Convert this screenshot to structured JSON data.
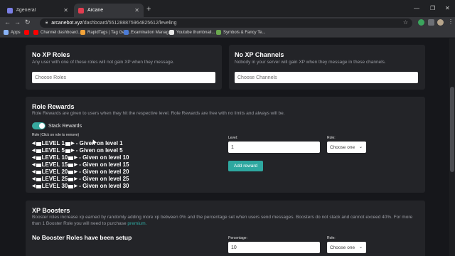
{
  "browser": {
    "tabs": [
      {
        "label": "#general",
        "active": false
      },
      {
        "label": "Arcane",
        "active": true
      }
    ],
    "url_host": "arcanebot.xyz",
    "url_path": "/dashboard/551288875964825612/leveling",
    "bookmarks": [
      "Apps",
      "Channel dashboard...",
      "RapidTags | Tag Gen...",
      "Examination Manag...",
      "Youtube thumbnail...",
      "Symbols & Fancy Te..."
    ]
  },
  "no_xp_roles": {
    "title": "No XP Roles",
    "description": "Any user with one of these roles will not gain XP when they message.",
    "placeholder": "Choose Roles"
  },
  "no_xp_channels": {
    "title": "No XP Channels",
    "description": "Nobody in your server will gain XP when they message in these channels.",
    "placeholder": "Choose Channels"
  },
  "role_rewards": {
    "title": "Role Rewards",
    "description": "Role Rewards are given to users when they hit the respective level. Role Rewards are free with no limits and always will be.",
    "stack_label": "Stack Rewards",
    "stack_enabled": true,
    "list_label": "Role (Click on role to remove)",
    "rewards": [
      {
        "name": "LEVEL 1",
        "text": "- Given on level 1"
      },
      {
        "name": "LEVEL 5",
        "text": "- Given on level 5"
      },
      {
        "name": "LEVEL 10",
        "text": "- Given on level 10"
      },
      {
        "name": "LEVEL 15",
        "text": "- Given on level 15"
      },
      {
        "name": "LEVEL 20",
        "text": "- Given on level 20"
      },
      {
        "name": "LEVEL 25",
        "text": "- Given on level 25"
      },
      {
        "name": "LEVEL 30",
        "text": "- Given on level 30"
      }
    ],
    "level_label": "Level:",
    "level_value": "1",
    "role_label": "Role:",
    "role_select": "Choose one",
    "add_button": "Add reward"
  },
  "xp_boosters": {
    "title": "XP Boosters",
    "description_1": "Booster roles increase xp earned by randomly adding more xp between 0% and the percentage set when users send messages. Boosters do not stack and cannot exceed 40%. For more",
    "description_2": "than 1 Booster Role you will need to purchase",
    "premium_link": "premium.",
    "empty_text": "No Booster Roles have been setup",
    "percentage_label": "Percentage:",
    "percentage_value": "10",
    "role_label": "Role:",
    "role_select": "Choose one"
  },
  "colors": {
    "accent": "#2ea8a0",
    "card": "#232428",
    "background": "#16171b"
  }
}
